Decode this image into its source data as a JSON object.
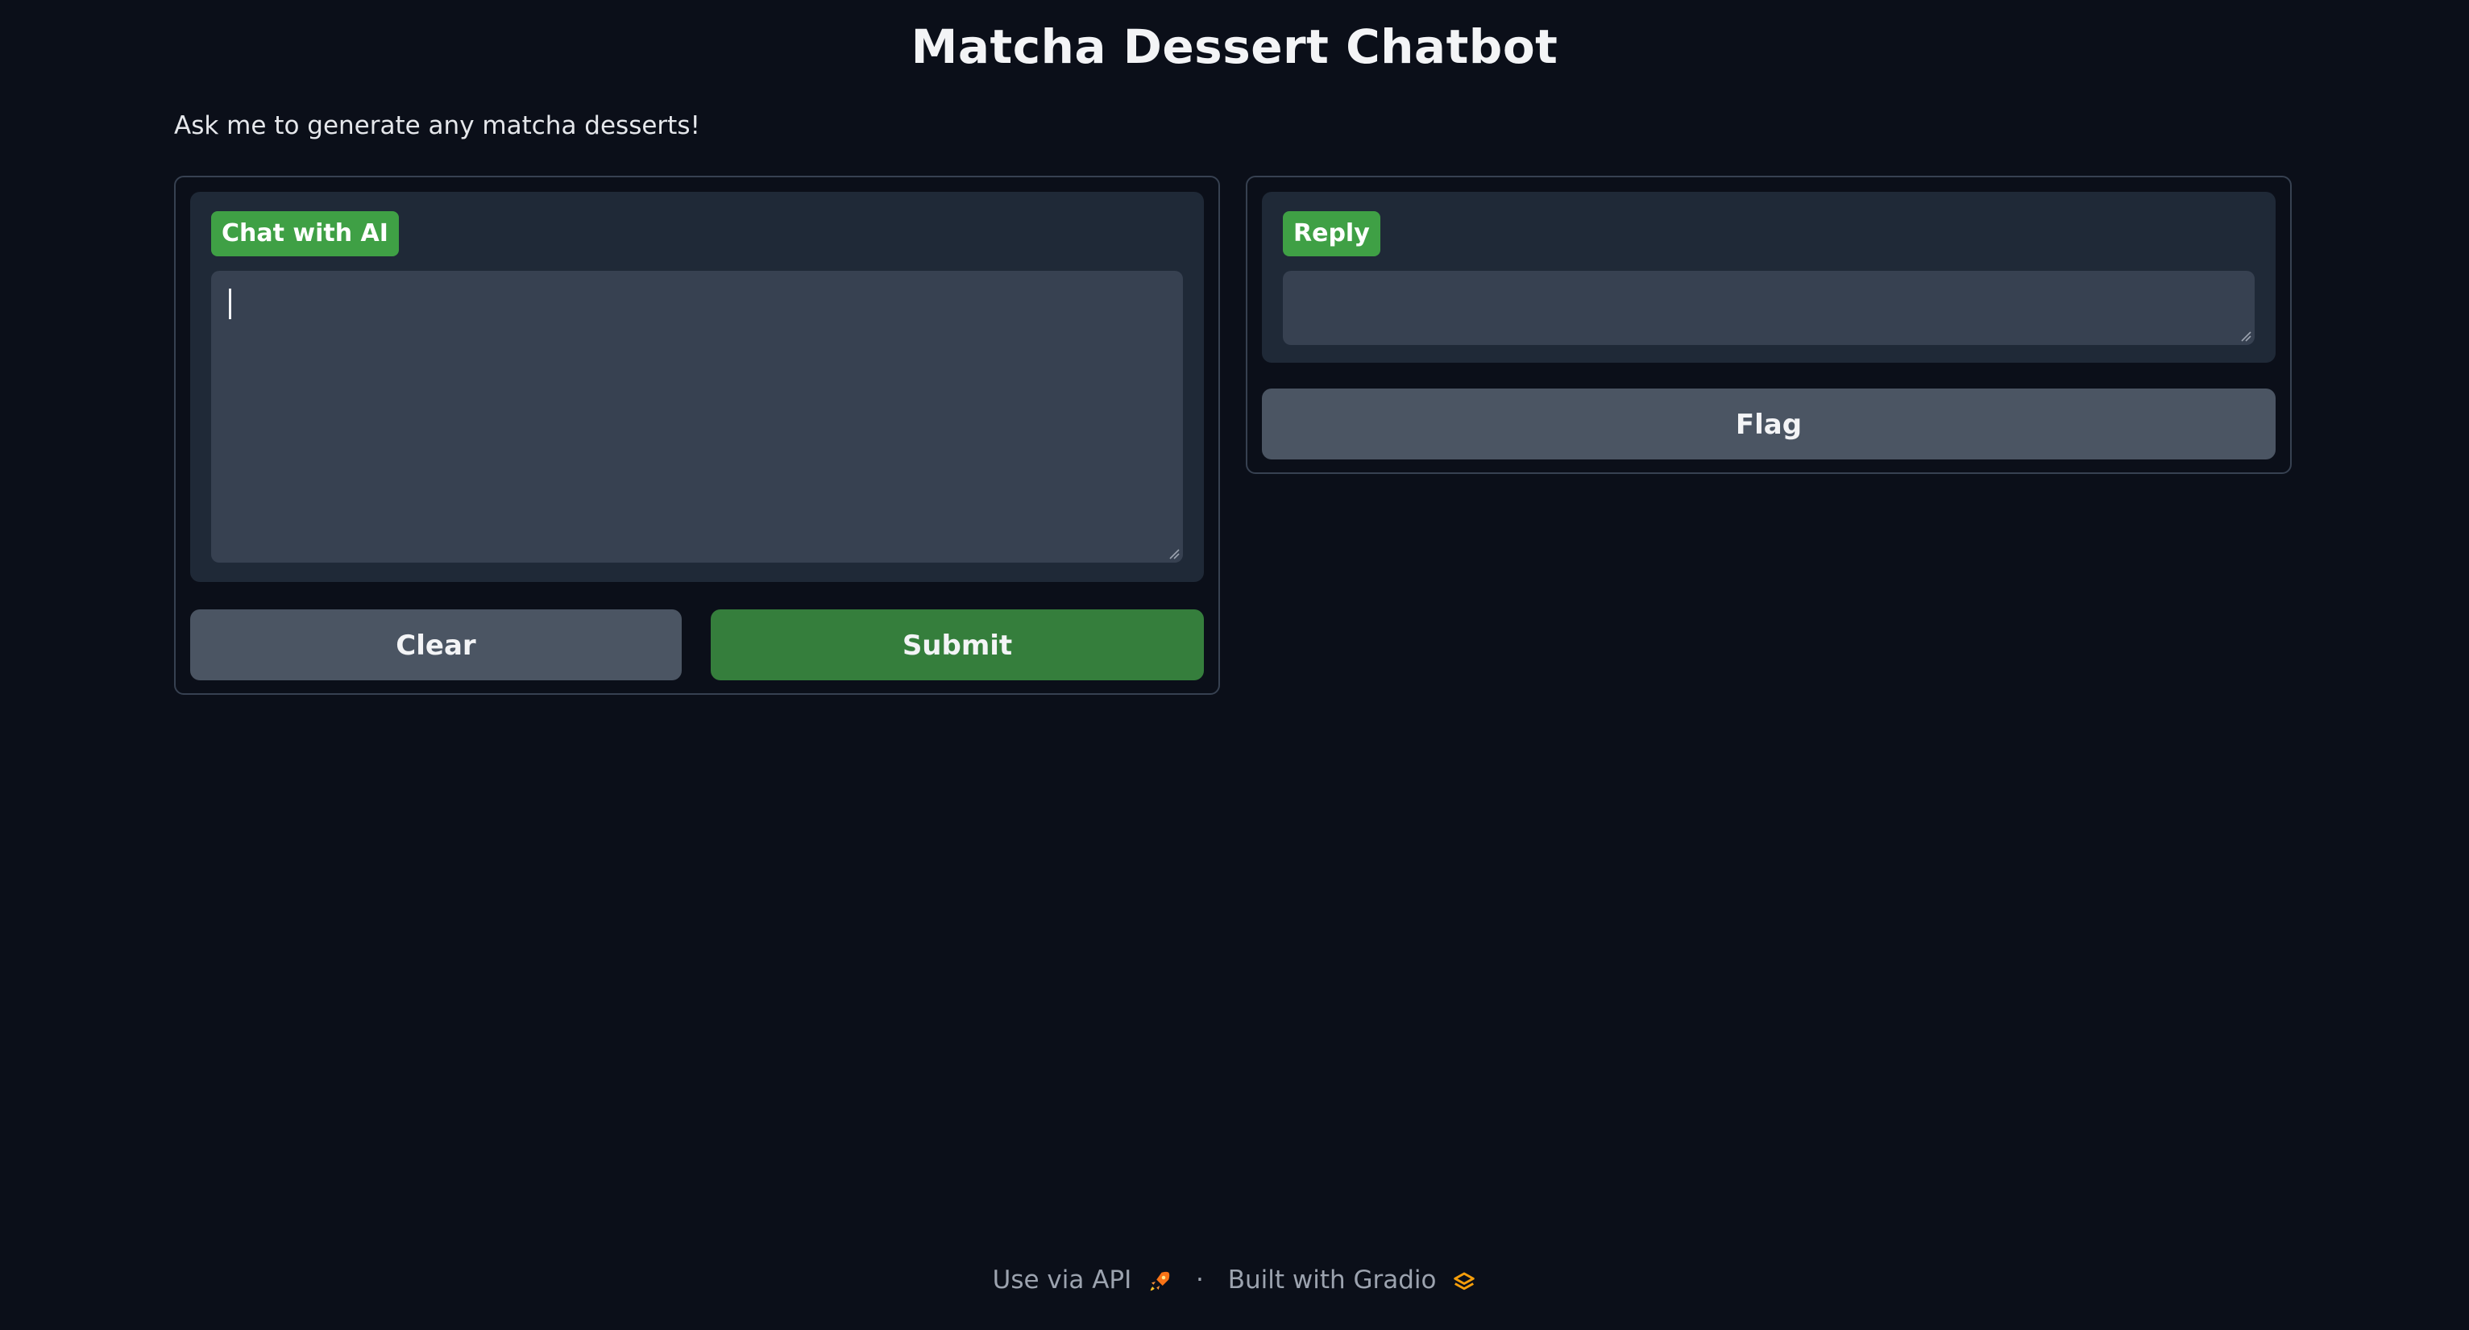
{
  "header": {
    "title": "Matcha Dessert Chatbot",
    "description": "Ask me to generate any matcha desserts!"
  },
  "input_panel": {
    "label": "Chat with AI",
    "value": "",
    "clear_label": "Clear",
    "submit_label": "Submit"
  },
  "output_panel": {
    "label": "Reply",
    "value": "",
    "flag_label": "Flag"
  },
  "footer": {
    "api_label": "Use via API",
    "separator": "·",
    "built_label": "Built with Gradio",
    "api_icon": "rocket-icon",
    "gradio_icon": "gradio-logo-icon"
  },
  "colors": {
    "background": "#0b0f19",
    "accent_green": "#3fa045",
    "submit_green": "#357e3c",
    "secondary_button": "#4b5563",
    "block_background": "#1f2937",
    "input_background": "#374151"
  }
}
